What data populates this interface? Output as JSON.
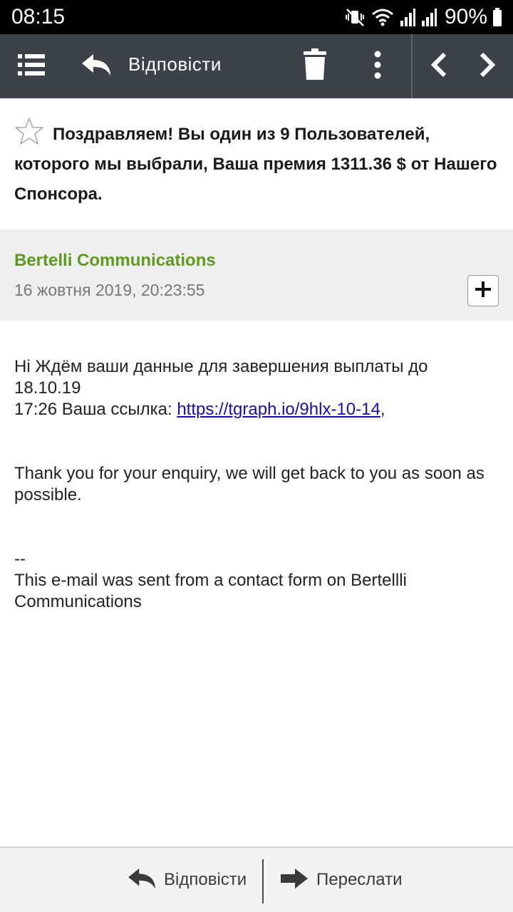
{
  "status_bar": {
    "time": "08:15",
    "battery": "90%",
    "icons": [
      "mute-vibrate-icon",
      "wifi-icon",
      "signal-icon",
      "signal-icon",
      "battery-icon"
    ]
  },
  "toolbar": {
    "reply_label": "Відповісти",
    "icons": [
      "menu-icon",
      "reply-icon",
      "trash-icon",
      "more-vert-icon",
      "chevron-left-icon",
      "chevron-right-icon"
    ]
  },
  "email": {
    "subject": "Поздравляем! Вы один из 9 Пользователей, которого мы выбрали, Ваша премия 1311.36 $ от Нашего Спонсора.",
    "starred": false,
    "sender": "Bertelli Communications",
    "date": "16 жовтня 2019, 20:23:55",
    "body": {
      "line1": "Hi Ждём ваши данные для  завершения выплаты до 18.10.19",
      "line2_prefix": "17:26 Ваша ссылка: ",
      "link": "https://tgraph.io/9hlx-10-14",
      "line2_suffix": ",",
      "paragraph2": "Thank you for your enquiry, we will get back to you as soon as possible.",
      "signature_dash": "--",
      "signature": "This e-mail was sent from a contact form on Bertellli Communications"
    }
  },
  "bottom_bar": {
    "reply_label": "Відповісти",
    "forward_label": "Переслати"
  },
  "colors": {
    "toolbar_bg": "#3c4248",
    "sender_name": "#5e9a1f",
    "link": "#1a0dab"
  }
}
